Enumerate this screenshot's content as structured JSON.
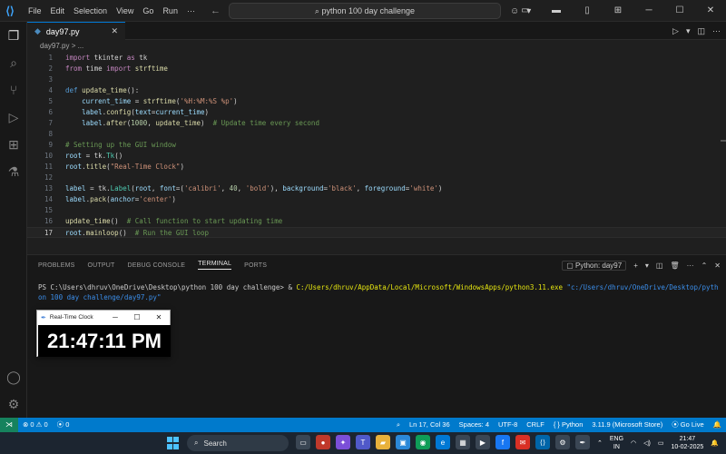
{
  "titlebar": {
    "menu": [
      "File",
      "Edit",
      "Selection",
      "View",
      "Go",
      "Run",
      "···"
    ],
    "search": "python 100 day challenge"
  },
  "tab": {
    "filename": "day97.py"
  },
  "breadcrumb": "day97.py > ...",
  "editor": {
    "lines": [
      {
        "n": "1",
        "html": "<span class=\"kw\">import</span> tkinter <span class=\"kw\">as</span> tk"
      },
      {
        "n": "2",
        "html": "<span class=\"kw\">from</span> time <span class=\"kw\">import</span> <span class=\"fn\">strftime</span>"
      },
      {
        "n": "3",
        "html": ""
      },
      {
        "n": "4",
        "html": "<span class=\"kw2\">def</span> <span class=\"fn\">update_time</span>():"
      },
      {
        "n": "5",
        "html": "    <span class=\"var\">current_time</span> = <span class=\"fn\">strftime</span>(<span class=\"str\">'%H:%M:%S %p'</span>)"
      },
      {
        "n": "6",
        "html": "    <span class=\"var\">label</span>.<span class=\"fn\">config</span>(<span class=\"var\">text</span>=<span class=\"var\">current_time</span>)"
      },
      {
        "n": "7",
        "html": "    <span class=\"var\">label</span>.<span class=\"fn\">after</span>(<span class=\"num\">1000</span>, <span class=\"fn\">update_time</span>)  <span class=\"cm\"># Update time every second</span>"
      },
      {
        "n": "8",
        "html": ""
      },
      {
        "n": "9",
        "html": "<span class=\"cm\"># Setting up the GUI window</span>"
      },
      {
        "n": "10",
        "html": "<span class=\"var\">root</span> = tk.<span class=\"cls\">Tk</span>()"
      },
      {
        "n": "11",
        "html": "<span class=\"var\">root</span>.<span class=\"fn\">title</span>(<span class=\"str\">\"Real-Time Clock\"</span>)"
      },
      {
        "n": "12",
        "html": ""
      },
      {
        "n": "13",
        "html": "<span class=\"var\">label</span> = tk.<span class=\"cls\">Label</span>(<span class=\"var\">root</span>, <span class=\"var\">font</span>=(<span class=\"str\">'calibri'</span>, <span class=\"num\">40</span>, <span class=\"str\">'bold'</span>), <span class=\"var\">background</span>=<span class=\"str\">'black'</span>, <span class=\"var\">foreground</span>=<span class=\"str\">'white'</span>)"
      },
      {
        "n": "14",
        "html": "<span class=\"var\">label</span>.<span class=\"fn\">pack</span>(<span class=\"var\">anchor</span>=<span class=\"str\">'center'</span>)"
      },
      {
        "n": "15",
        "html": ""
      },
      {
        "n": "16",
        "html": "<span class=\"fn\">update_time</span>()  <span class=\"cm\"># Call function to start updating time</span>"
      },
      {
        "n": "17",
        "html": "<span class=\"var\">root</span>.<span class=\"fn\">mainloop</span>()  <span class=\"cm\"># Run the GUI loop</span>"
      }
    ],
    "active_line": "17"
  },
  "panel": {
    "tabs": [
      "PROBLEMS",
      "OUTPUT",
      "DEBUG CONSOLE",
      "TERMINAL",
      "PORTS"
    ],
    "active_tab": "TERMINAL",
    "terminal_name": "Python: day97",
    "terminal": {
      "prompt": "PS C:\\Users\\dhruv\\OneDrive\\Desktop\\python 100 day challenge> & ",
      "exe": "C:/Users/dhruv/AppData/Local/Microsoft/WindowsApps/python3.11.exe",
      "arg": " \"c:/Users/dhruv/OneDrive/Desktop/python 100 day challenge/day97.py\""
    }
  },
  "tk_window": {
    "title": "Real-Time Clock",
    "time": "21:47:11 PM"
  },
  "statusbar": {
    "errors": "0",
    "warnings": "0",
    "ports": "0",
    "position": "Ln 17, Col 36",
    "spaces": "Spaces: 4",
    "encoding": "UTF-8",
    "eol": "CRLF",
    "language": "Python",
    "interpreter": "3.11.9 (Microsoft Store)",
    "golive": "Go Live"
  },
  "taskbar": {
    "search": "Search",
    "lang_top": "ENG",
    "lang_bottom": "IN",
    "time": "21:47",
    "date": "10-02-2025"
  },
  "colors": {
    "accent": "#007acc",
    "editor_bg": "#1f1f1f",
    "panel_bg": "#181818"
  }
}
